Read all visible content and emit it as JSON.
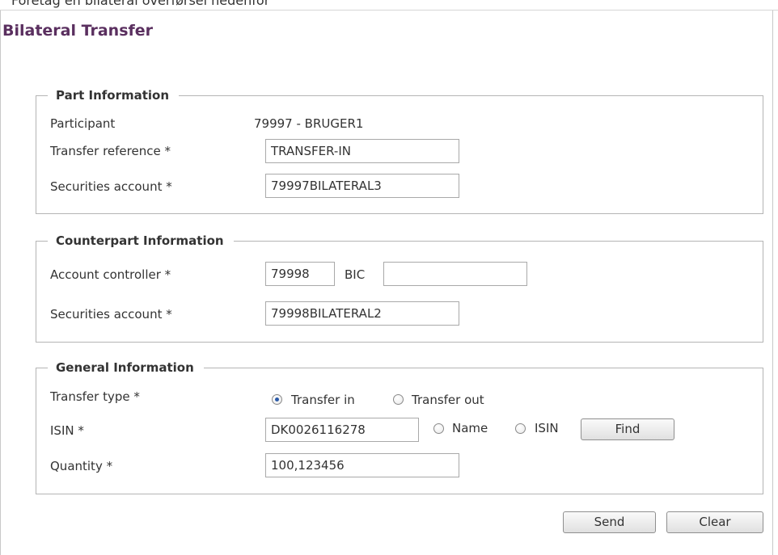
{
  "top_cropped_text": "Foretag en bilateral overførsel nedenfor",
  "page": {
    "title": "Bilateral Transfer"
  },
  "part_info": {
    "legend": "Part Information",
    "participant_label": "Participant",
    "participant_value": "79997 - BRUGER1",
    "transfer_reference_label": "Transfer reference *",
    "transfer_reference_value": "TRANSFER-IN",
    "securities_account_label": "Securities account *",
    "securities_account_value": "79997BILATERAL3"
  },
  "counterpart_info": {
    "legend": "Counterpart Information",
    "account_controller_label": "Account controller *",
    "account_controller_value": "79998",
    "bic_label": "BIC",
    "bic_value": "",
    "securities_account_label": "Securities account *",
    "securities_account_value": "79998BILATERAL2"
  },
  "general_info": {
    "legend": "General Information",
    "transfer_type_label": "Transfer type *",
    "transfer_type_options": [
      {
        "label": "Transfer in",
        "checked": true
      },
      {
        "label": "Transfer out",
        "checked": false
      }
    ],
    "isin_label": "ISIN *",
    "isin_value": "DK0026116278",
    "search_by_options": [
      {
        "label": "Name",
        "checked": false
      },
      {
        "label": "ISIN",
        "checked": false
      }
    ],
    "find_label": "Find",
    "quantity_label": "Quantity *",
    "quantity_value": "100,123456"
  },
  "actions": {
    "send_label": "Send",
    "clear_label": "Clear"
  }
}
